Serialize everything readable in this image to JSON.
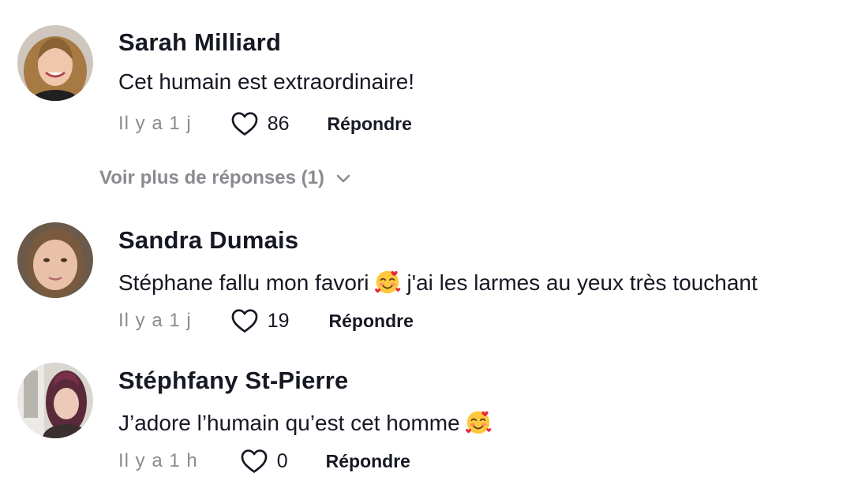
{
  "comments": [
    {
      "author": "Sarah Milliard",
      "text": "Cet humain est extraordinaire!",
      "time": "Il y a 1 j",
      "likes": "86",
      "reply_label": "Répondre",
      "more_replies": "Voir plus de réponses (1)"
    },
    {
      "author": "Sandra Dumais",
      "text_before": "Stéphane fallu mon favori",
      "text_after": "j'ai les larmes au yeux très touchant",
      "emoji": "smiling-face-with-hearts-emoji",
      "time": "Il y a 1 j",
      "likes": "19",
      "reply_label": "Répondre"
    },
    {
      "author": "Stéphfany St-Pierre",
      "text_before": "J’adore l’humain qu’est cet homme",
      "emoji": "smiling-face-with-hearts-emoji",
      "time": "Il y a 1 h",
      "likes": "0",
      "reply_label": "Répondre"
    }
  ],
  "colors": {
    "text": "#161823",
    "muted": "#8a8b91"
  }
}
